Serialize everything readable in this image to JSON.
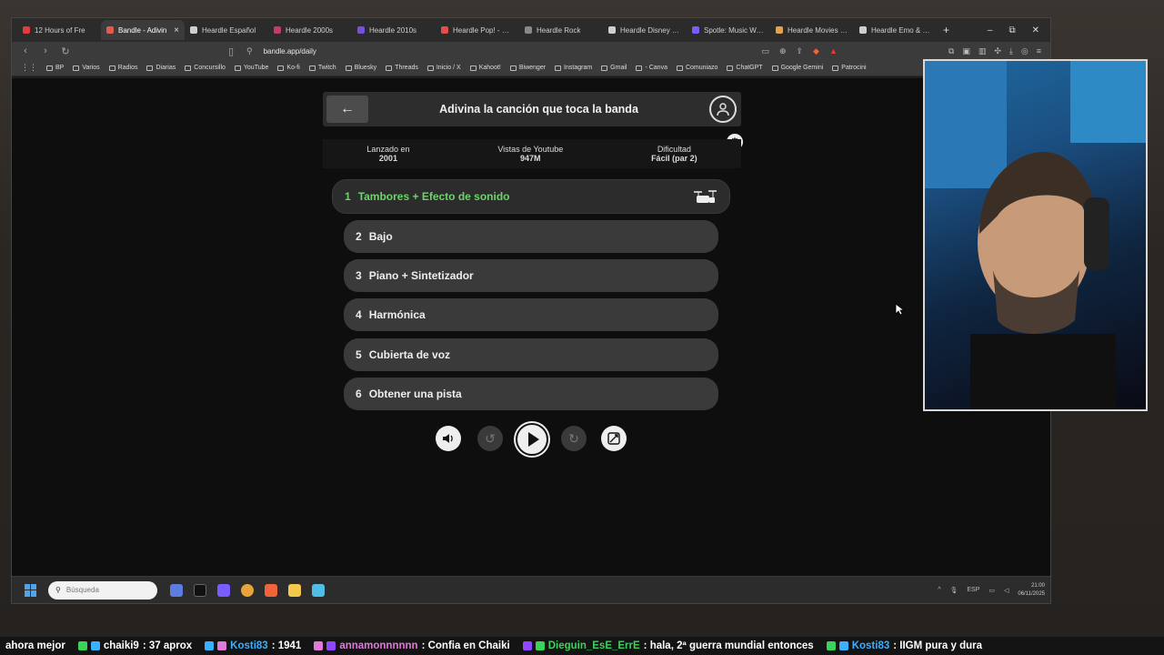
{
  "browser": {
    "tabs": [
      {
        "label": "12 Hours of Fre",
        "color": "#e33a3a",
        "active": false
      },
      {
        "label": "Bandle - Adivin",
        "color": "#e25b4d",
        "active": true
      },
      {
        "label": "Heardle Español",
        "color": "#cfcfcf",
        "active": false
      },
      {
        "label": "Heardle 2000s",
        "color": "#c43b6a",
        "active": false
      },
      {
        "label": "Heardle 2010s",
        "color": "#7b4de0",
        "active": false
      },
      {
        "label": "Heardle Pop! - Can",
        "color": "#e24e4e",
        "active": false
      },
      {
        "label": "Heardle Rock",
        "color": "#888888",
        "active": false
      },
      {
        "label": "Heardle Disney - Do",
        "color": "#cfcfcf",
        "active": false
      },
      {
        "label": "Spotle: Music Word",
        "color": "#7a5cff",
        "active": false
      },
      {
        "label": "Heardle Movies - Te",
        "color": "#e2a14d",
        "active": false
      },
      {
        "label": "Heardle Emo & Pop",
        "color": "#cfcfcf",
        "active": false
      }
    ],
    "close_symbol": "×",
    "new_tab_symbol": "+",
    "window_controls": [
      "–",
      "⧉",
      "✕"
    ],
    "url": "bandle.app/daily",
    "bookmarks": [
      "BP",
      "Varios",
      "Radios",
      "Diarias",
      "Concursillo",
      "YouTube",
      "Ko-fi",
      "Twitch",
      "Bluesky",
      "Threads",
      "Inicio / X",
      "Kahoot!",
      "Biwenger",
      "Instagram",
      "Gmail",
      "- Canva",
      "Comuniazo",
      "ChatGPT",
      "Google Gemini",
      "Patrocini"
    ]
  },
  "app": {
    "title": "Adivina la canción que toca la banda",
    "back_icon": "arrow-left-icon",
    "profile_icon": "user-icon",
    "settings_icon": "gear-icon",
    "stats": [
      {
        "label": "Lanzado en",
        "value": "2001"
      },
      {
        "label": "Vistas de Youtube",
        "value": "947M"
      },
      {
        "label": "Dificultad",
        "value": "Fácil (par 2)"
      }
    ],
    "rows": [
      {
        "num": "1",
        "label": "Tambores + Efecto de sonido",
        "active": true
      },
      {
        "num": "2",
        "label": "Bajo",
        "active": false
      },
      {
        "num": "3",
        "label": "Piano + Sintetizador",
        "active": false
      },
      {
        "num": "4",
        "label": "Harmónica",
        "active": false
      },
      {
        "num": "5",
        "label": "Cubierta de voz",
        "active": false
      },
      {
        "num": "6",
        "label": "Obtener una pista",
        "active": false
      }
    ],
    "controls": [
      "volume-icon",
      "rewind-icon",
      "play-icon",
      "forward-icon",
      "skip-icon"
    ],
    "accent": "#6ed36a"
  },
  "taskbar": {
    "search_placeholder": "Búsqueda",
    "lang": "ESP",
    "time": "21:00",
    "date": "06/11/2025"
  },
  "chat": [
    {
      "user": "",
      "msg": "ahora mejor",
      "color": "#ffffff"
    },
    {
      "user": "chaiki9",
      "msg": ": 37 aprox",
      "color": "#ffffff"
    },
    {
      "user": "Kosti83",
      "msg": ": 1941",
      "color": "#3ab0ff"
    },
    {
      "user": "annamonnnnnn",
      "msg": ": Confia en Chaiki",
      "color": "#e07ad8"
    },
    {
      "user": "Dieguin_EsE_ErrE",
      "msg": ": hala, 2ª guerra mundial entonces",
      "color": "#3ad35a"
    },
    {
      "user": "Kosti83",
      "msg": ": IIGM pura y dura",
      "color": "#3ab0ff"
    }
  ]
}
